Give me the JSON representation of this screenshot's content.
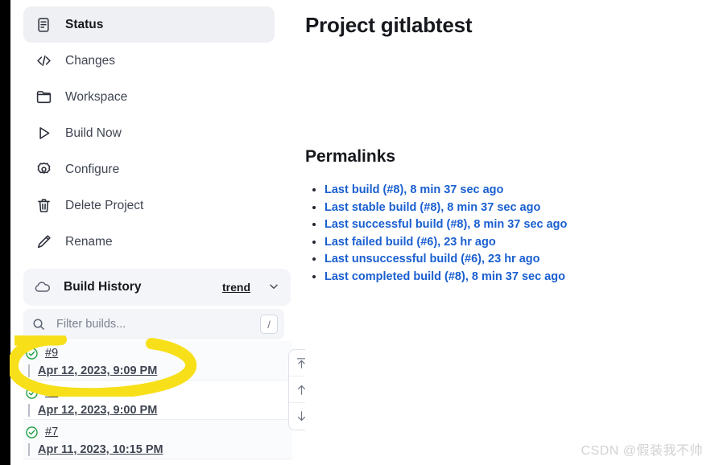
{
  "window": {
    "left_rail_color": "#000000"
  },
  "sidebar": {
    "nav": [
      {
        "label": "Status",
        "icon": "document-status-icon",
        "active": true
      },
      {
        "label": "Changes",
        "icon": "code-brackets-icon",
        "active": false
      },
      {
        "label": "Workspace",
        "icon": "folder-icon",
        "active": false
      },
      {
        "label": "Build Now",
        "icon": "play-triangle-icon",
        "active": false
      },
      {
        "label": "Configure",
        "icon": "gear-icon",
        "active": false
      },
      {
        "label": "Delete Project",
        "icon": "trash-icon",
        "active": false
      },
      {
        "label": "Rename",
        "icon": "pencil-icon",
        "active": false
      }
    ],
    "build_history": {
      "title": "Build History",
      "icon": "cloud-icon",
      "trend_label": "trend",
      "caret_icon": "chevron-down-icon",
      "search": {
        "placeholder": "Filter builds...",
        "value": "",
        "icon": "search-icon",
        "shortcut_key": "/"
      },
      "rows": [
        {
          "number": "#9",
          "date": "Apr 12, 2023, 9:09 PM",
          "status": "success"
        },
        {
          "number": "#8",
          "date": "Apr 12, 2023, 9:00 PM",
          "status": "success"
        },
        {
          "number": "#7",
          "date": "Apr 11, 2023, 10:15 PM",
          "status": "success"
        }
      ],
      "scroll_buttons": [
        {
          "icon": "arrow-up-to-line-icon"
        },
        {
          "icon": "arrow-up-icon"
        },
        {
          "icon": "arrow-down-icon"
        }
      ]
    }
  },
  "main": {
    "page_title": "Project gitlabtest",
    "section_title": "Permalinks",
    "permalinks": [
      "Last build (#8), 8 min 37 sec ago",
      "Last stable build (#8), 8 min 37 sec ago",
      "Last successful build (#8), 8 min 37 sec ago",
      "Last failed build (#6), 23 hr ago",
      "Last unsuccessful build (#6), 23 hr ago",
      "Last completed build (#8), 8 min 37 sec ago"
    ]
  },
  "annotation": {
    "type": "highlighter-oval",
    "color": "#f7e019",
    "targets": "build-row-9"
  },
  "watermark": {
    "text": "CSDN @假装我不帅"
  },
  "colors": {
    "link": "#1a5fd0",
    "success": "#1a9e3f",
    "active_nav_bg": "#eef0f3",
    "panel_bg": "#f4f5f8",
    "highlighter": "#f7e019"
  }
}
